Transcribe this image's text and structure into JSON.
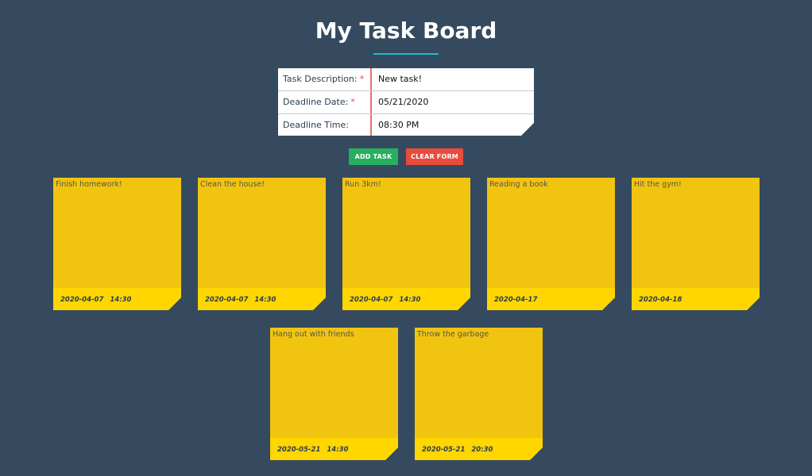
{
  "title": "My Task Board",
  "colors": {
    "background": "#354a5f",
    "underline": "#1abccf",
    "add_button": "#27ae60",
    "clear_button": "#e74c3c",
    "note": "#f1c40f",
    "note_footer": "#ffd600"
  },
  "form": {
    "description_label": "Task Description:",
    "description_required": "*",
    "description_value": "New task!",
    "date_label": "Deadline Date:",
    "date_required": "*",
    "date_value": "05/21/2020",
    "time_label": "Deadline Time:",
    "time_value": "08:30 PM"
  },
  "buttons": {
    "add": "ADD TASK",
    "clear": "CLEAR FORM"
  },
  "tasks": [
    {
      "text": "Finish homework!",
      "date": "2020-04-07",
      "time": "14:30"
    },
    {
      "text": "Clean the house!",
      "date": "2020-04-07",
      "time": "14:30"
    },
    {
      "text": "Run 3km!",
      "date": "2020-04-07",
      "time": "14:30"
    },
    {
      "text": "Reading a book",
      "date": "2020-04-17",
      "time": ""
    },
    {
      "text": "Hit the gym!",
      "date": "2020-04-18",
      "time": ""
    },
    {
      "text": "Hang out with friends",
      "date": "2020-05-21",
      "time": "14:30"
    },
    {
      "text": "Throw the garbage",
      "date": "2020-05-21",
      "time": "20:30"
    }
  ]
}
